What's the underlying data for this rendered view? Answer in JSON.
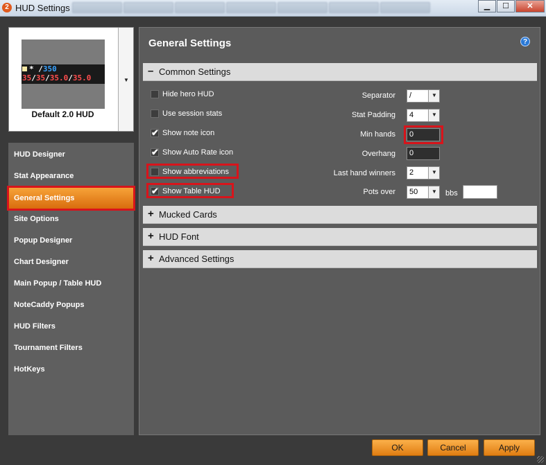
{
  "window": {
    "title": "HUD Settings",
    "app_icon_text": "2",
    "minimize": "▁",
    "maximize": "☐",
    "close": "✕"
  },
  "preview": {
    "label": "Default 2.0 HUD",
    "hud_line1": {
      "star": "*",
      "slash": "/",
      "value": "350"
    },
    "hud_line2": [
      "35",
      "35",
      "35.0",
      "35.0"
    ],
    "dropdown_icon": "▼"
  },
  "nav": {
    "items": [
      {
        "label": "HUD Designer",
        "active": false
      },
      {
        "label": "Stat Appearance",
        "active": false
      },
      {
        "label": "General Settings",
        "active": true
      },
      {
        "label": "Site Options",
        "active": false
      },
      {
        "label": "Popup Designer",
        "active": false
      },
      {
        "label": "Chart Designer",
        "active": false
      },
      {
        "label": "Main Popup / Table HUD",
        "active": false
      },
      {
        "label": "NoteCaddy Popups",
        "active": false
      },
      {
        "label": "HUD Filters",
        "active": false
      },
      {
        "label": "Tournament Filters",
        "active": false
      },
      {
        "label": "HotKeys",
        "active": false
      }
    ]
  },
  "panel": {
    "title": "General Settings",
    "help_icon": "?",
    "sections": [
      {
        "label": "Common Settings",
        "sign": "–",
        "expanded": true
      },
      {
        "label": "Mucked Cards",
        "sign": "+",
        "expanded": false
      },
      {
        "label": "HUD Font",
        "sign": "+",
        "expanded": false
      },
      {
        "label": "Advanced Settings",
        "sign": "+",
        "expanded": false
      }
    ],
    "checkboxes": [
      {
        "label": "Hide hero HUD",
        "checked": false
      },
      {
        "label": "Use session stats",
        "checked": false
      },
      {
        "label": "Show note icon",
        "checked": true
      },
      {
        "label": "Show Auto Rate icon",
        "checked": true
      },
      {
        "label": "Show abbreviations",
        "checked": false
      },
      {
        "label": "Show Table HUD",
        "checked": true
      }
    ],
    "check_mark": "✔",
    "fields": {
      "separator": {
        "label": "Separator",
        "value": "/"
      },
      "stat_padding": {
        "label": "Stat Padding",
        "value": "4"
      },
      "min_hands": {
        "label": "Min hands",
        "value": "0"
      },
      "overhang": {
        "label": "Overhang",
        "value": "0"
      },
      "last_hand_winners": {
        "label": "Last hand winners",
        "value": "2"
      },
      "pots_over": {
        "label": "Pots over",
        "value": "50",
        "unit": "bbs",
        "extra_value": ""
      }
    },
    "combo_arrow": "▼"
  },
  "footer": {
    "ok": "OK",
    "cancel": "Cancel",
    "apply": "Apply"
  },
  "colors": {
    "accent_orange": "#f29a2e",
    "highlight_red": "#d8141b",
    "panel_gray": "#5b5b5b"
  }
}
